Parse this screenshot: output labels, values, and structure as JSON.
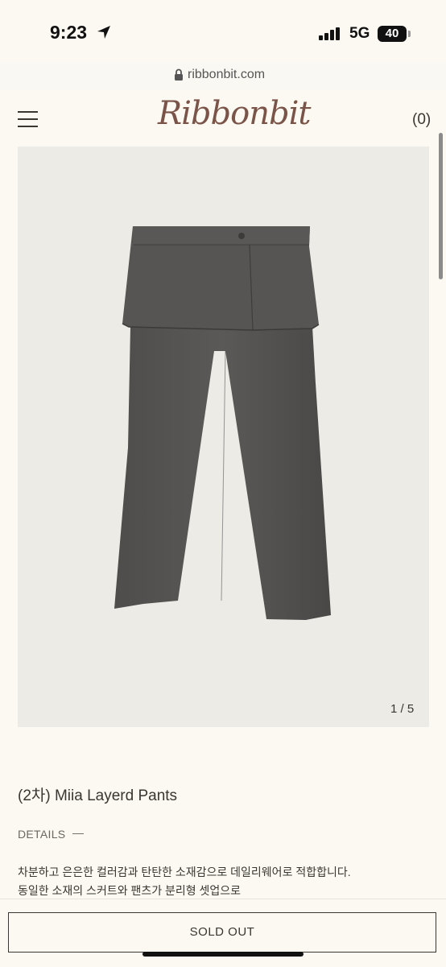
{
  "status_bar": {
    "time": "9:23",
    "network": "5G",
    "battery": "40"
  },
  "browser": {
    "url": "ribbonbit.com"
  },
  "header": {
    "logo": "Ribbonbit",
    "cart": "(0)",
    "icons": [
      "menu-icon",
      "lock-icon",
      "location-arrow-icon",
      "signal-icon"
    ]
  },
  "gallery": {
    "counter": "1 / 5"
  },
  "product": {
    "title": "(2차) Miia Layerd Pants",
    "details_label": "DETAILS",
    "details_dash": "—",
    "description": [
      "차분하고 은은한 컬러감과 탄탄한 소재감으로 데일리웨어로 적합합니다.",
      "동일한 소재의 스커트와 팬츠가 분리형 셋업으로"
    ]
  },
  "actions": {
    "sold_out": "SOLD OUT"
  },
  "colors": {
    "background": "#fbf9f1",
    "gallery_bg": "#ecebe6",
    "logo": "#7a5448",
    "product": "#4a4846"
  }
}
